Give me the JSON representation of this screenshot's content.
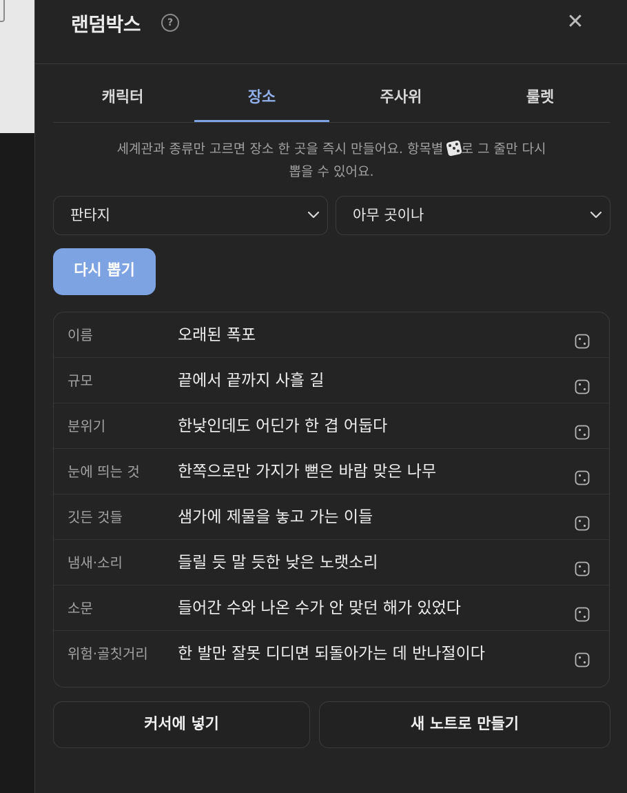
{
  "modal": {
    "title": "랜덤박스",
    "help_glyph": "?",
    "close_glyph": "✕"
  },
  "tabs": [
    {
      "label": "캐릭터",
      "active": false
    },
    {
      "label": "장소",
      "active": true
    },
    {
      "label": "주사위",
      "active": false
    },
    {
      "label": "룰렛",
      "active": false
    }
  ],
  "description": {
    "before_icon": "세계관과 종류만 고르면 장소 한 곳을 즉시 만들어요. 항목별 ",
    "after_icon": "로 그 줄만 다시",
    "line2": "뽑을 수 있어요."
  },
  "selects": {
    "world": "판타지",
    "kind": "아무 곳이나"
  },
  "redraw_label": "다시 뽑기",
  "rows": [
    {
      "label": "이름",
      "value": "오래된 폭포"
    },
    {
      "label": "규모",
      "value": "끝에서 끝까지 사흘 길"
    },
    {
      "label": "분위기",
      "value": "한낮인데도 어딘가 한 겹 어둡다"
    },
    {
      "label": "눈에 띄는 것",
      "value": "한쪽으로만 가지가 뻗은 바람 맞은 나무"
    },
    {
      "label": "깃든 것들",
      "value": "샘가에 제물을 놓고 가는 이들"
    },
    {
      "label": "냄새·소리",
      "value": "들릴 듯 말 듯한 낮은 노랫소리"
    },
    {
      "label": "소문",
      "value": "들어간 수와 나온 수가 안 맞던 해가 있었다"
    },
    {
      "label": "위험·골칫거리",
      "value": "한 발만 잘못 디디면 되돌아가는 데 반나절이다"
    }
  ],
  "actions": {
    "insert_at_cursor": "커서에 넣기",
    "new_note": "새 노트로 만들기"
  },
  "colors": {
    "accent": "#7ea3e3",
    "background": "#242424"
  }
}
